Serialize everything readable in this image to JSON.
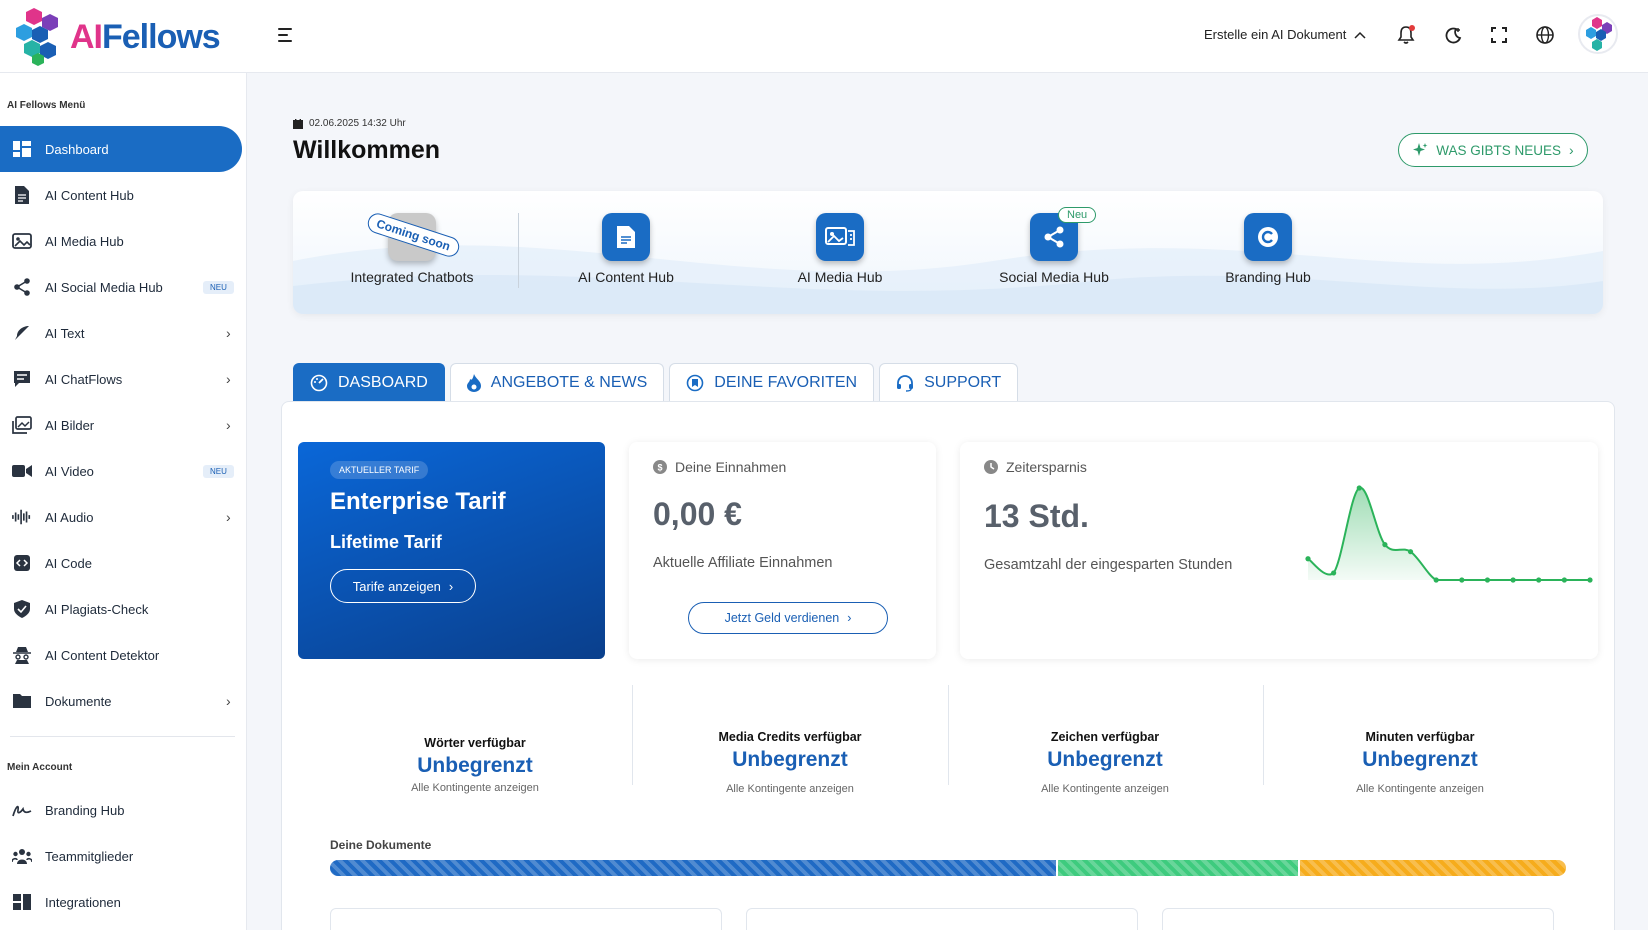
{
  "brand": {
    "logo_ai": "AI",
    "logo_fellows": "Fellows"
  },
  "header": {
    "create_doc_label": "Erstelle ein AI Dokument"
  },
  "sidebar": {
    "section_main": "AI Fellows Menü",
    "items": [
      {
        "label": "Dashboard",
        "icon": "dashboard-icon",
        "active": true
      },
      {
        "label": "AI Content Hub",
        "icon": "document-icon"
      },
      {
        "label": "AI Media Hub",
        "icon": "media-icon"
      },
      {
        "label": "AI Social Media Hub",
        "icon": "share-icon",
        "badge": "NEU"
      },
      {
        "label": "AI Text",
        "icon": "feather-icon",
        "chevron": true
      },
      {
        "label": "AI ChatFlows",
        "icon": "chat-icon",
        "chevron": true
      },
      {
        "label": "AI Bilder",
        "icon": "image-icon",
        "chevron": true
      },
      {
        "label": "AI Video",
        "icon": "video-icon",
        "badge": "NEU"
      },
      {
        "label": "AI Audio",
        "icon": "audio-icon",
        "chevron": true
      },
      {
        "label": "AI Code",
        "icon": "code-icon"
      },
      {
        "label": "AI Plagiats-Check",
        "icon": "shield-icon"
      },
      {
        "label": "AI Content Detektor",
        "icon": "detective-icon"
      },
      {
        "label": "Dokumente",
        "icon": "folder-icon",
        "chevron": true
      }
    ],
    "section_account": "Mein Account",
    "account_items": [
      {
        "label": "Branding Hub",
        "icon": "signature-icon"
      },
      {
        "label": "Teammitglieder",
        "icon": "team-icon"
      },
      {
        "label": "Integrationen",
        "icon": "integration-icon"
      }
    ]
  },
  "main": {
    "datetime": "02.06.2025 14:32 Uhr",
    "title": "Willkommen",
    "news_button": "WAS GIBTS NEUES",
    "hubs": [
      {
        "label": "Integrated Chatbots",
        "sticker": "Coming soon"
      },
      {
        "label": "AI Content Hub"
      },
      {
        "label": "AI Media Hub"
      },
      {
        "label": "Social Media Hub",
        "pill": "Neu"
      },
      {
        "label": "Branding Hub"
      }
    ],
    "tabs": [
      {
        "label": "DASBOARD",
        "active": true
      },
      {
        "label": "ANGEBOTE & NEWS"
      },
      {
        "label": "DEINE FAVORITEN"
      },
      {
        "label": "SUPPORT"
      }
    ],
    "tarif": {
      "pill": "AKTUELLER TARIF",
      "title": "Enterprise Tarif",
      "subtitle": "Lifetime Tarif",
      "button": "Tarife anzeigen"
    },
    "earnings": {
      "head": "Deine Einnahmen",
      "value": "0,00 €",
      "desc": "Aktuelle Affiliate Einnahmen",
      "button": "Jetzt Geld verdienen"
    },
    "savings": {
      "head": "Zeitersparnis",
      "value": "13 Std.",
      "desc": "Gesamtzahl der eingesparten Stunden"
    },
    "credits": [
      {
        "label": "Wörter verfügbar",
        "value": "Unbegrenzt",
        "link": "Alle Kontingente anzeigen"
      },
      {
        "label": "Media Credits verfügbar",
        "value": "Unbegrenzt",
        "link": "Alle Kontingente anzeigen"
      },
      {
        "label": "Zeichen verfügbar",
        "value": "Unbegrenzt",
        "link": "Alle Kontingente anzeigen"
      },
      {
        "label": "Minuten verfügbar",
        "value": "Unbegrenzt",
        "link": "Alle Kontingente anzeigen"
      }
    ],
    "docs_label": "Deine Dokumente",
    "docs_bar": [
      {
        "share": 0.587,
        "color": "#1f6ac4"
      },
      {
        "share": 0.196,
        "color": "#3ecb7e"
      },
      {
        "share": 0.217,
        "color": "#f6ac1c"
      }
    ]
  },
  "chart_data": {
    "type": "area",
    "values": [
      3,
      1,
      13,
      5,
      4,
      0,
      0,
      0,
      0,
      0,
      0,
      0
    ],
    "color": "#2bb35a"
  },
  "colors": {
    "primary": "#1a6cc4",
    "accent_green": "#2e9a6a",
    "brand_pink": "#e0348a"
  }
}
